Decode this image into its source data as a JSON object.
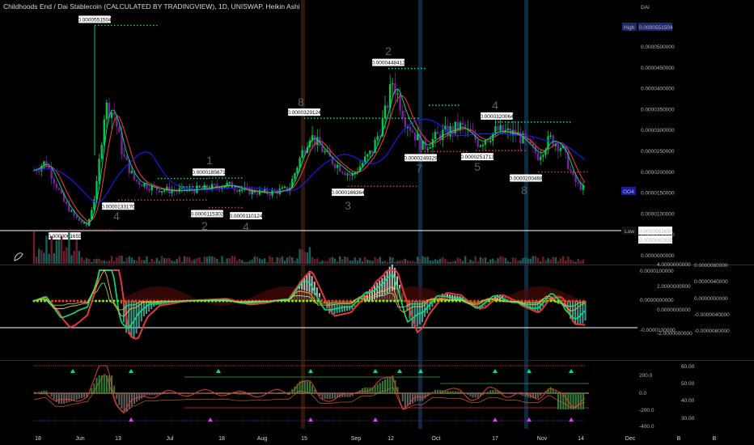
{
  "title": "Childhoods End / Dai Stablecoin (CALCULATED BY TRADINGVIEW), 1D, UNISWAP, Heikin Ashi",
  "currency": "DAI",
  "colors": {
    "background": "#000000",
    "up_candle": "#00c853",
    "down_candle": "#7b1fa2",
    "red_ma": "#e53935",
    "blue_ma": "#1a1aff",
    "green_ma": "#00e676",
    "level_green": "#00e676",
    "level_red": "#e53935"
  },
  "price_axis": {
    "ticks": [
      "0.0000500000",
      "0.0000450000",
      "0.0000400000",
      "0.0000350000",
      "0.0000300000",
      "0.0000250000",
      "0.0000200000",
      "0.0000150000",
      "0.0000100000",
      "0.0000050000",
      "0.0000000000"
    ],
    "high_label": "High",
    "high_value": "0.0000551504",
    "low_label": "Low",
    "low_value": "0.0000061655",
    "last_value": "0.0000061655",
    "current_tag": "OO4"
  },
  "x_axis": {
    "labels": [
      "18",
      "Jun",
      "13",
      "Jul",
      "18",
      "Aug",
      "15",
      "Sep",
      "12",
      "Oct",
      "17",
      "Nov",
      "14",
      "Dec",
      "B",
      "B"
    ]
  },
  "annotations": [
    {
      "text": "0.0000551504",
      "kind": "high"
    },
    {
      "text": "0.0000448412",
      "kind": "high"
    },
    {
      "text": "0.0000329124",
      "kind": "high"
    },
    {
      "text": "0.0000320064",
      "kind": "high"
    },
    {
      "text": "0.0000185671",
      "kind": "high"
    },
    {
      "text": "0.0000133170",
      "kind": "low"
    },
    {
      "text": "0.0000115302",
      "kind": "low"
    },
    {
      "text": "0.0000110124",
      "kind": "low"
    },
    {
      "text": "0.0000166364",
      "kind": "low"
    },
    {
      "text": "0.0000249329",
      "kind": "low"
    },
    {
      "text": "0.0000251713",
      "kind": "low"
    },
    {
      "text": "0.0000200468",
      "kind": "low"
    },
    {
      "text": "0.0000061655",
      "kind": "low"
    }
  ],
  "wave_numbers": [
    "4",
    "1",
    "2",
    "4",
    "8",
    "3",
    "2",
    "7",
    "5",
    "4",
    "8"
  ],
  "osc_axis": {
    "left_ticks": [
      "0.0000100000",
      "0.0000000000",
      "-0.0000100000"
    ],
    "mid_ticks": [
      "4.0000000000",
      "2.0000000000",
      "0.0000000000",
      "-2.0000000000"
    ],
    "right_ticks": [
      "0.0000080000",
      "0.0000040000",
      "0.0000000000",
      "-0.0000040000",
      "-0.0000080000"
    ]
  },
  "rsi_axis": {
    "left_ticks": [
      "200.0",
      "0.0",
      "-200.0",
      "-400.0"
    ],
    "right_ticks": [
      "60.00",
      "50.00",
      "40.00",
      "30.00"
    ]
  },
  "chart_data": {
    "type": "candlestick",
    "title": "Childhoods End / Dai Stablecoin (CALCULATED BY TRADINGVIEW), 1D, UNISWAP, Heikin Ashi",
    "ylim": [
      0,
      5.6e-05
    ],
    "y_unit": "DAI",
    "high": 5.51504e-05,
    "low": 6.1655e-06,
    "close_series": [
      {
        "date": "May 14",
        "value": 2.05e-05
      },
      {
        "date": "May 18",
        "value": 2.25e-05
      },
      {
        "date": "May 24",
        "value": 1.3e-05
      },
      {
        "date": "May 28",
        "value": 9e-06
      },
      {
        "date": "Jun 01",
        "value": 7e-06
      },
      {
        "date": "Jun 04",
        "value": 1.6e-05
      },
      {
        "date": "Jun 07",
        "value": 3.6e-05
      },
      {
        "date": "Jun 10",
        "value": 3.4e-05
      },
      {
        "date": "Jun 13",
        "value": 2.4e-05
      },
      {
        "date": "Jun 17",
        "value": 1.8e-05
      },
      {
        "date": "Jun 24",
        "value": 1.6e-05
      },
      {
        "date": "Jul 01",
        "value": 1.55e-05
      },
      {
        "date": "Jul 10",
        "value": 1.6e-05
      },
      {
        "date": "Jul 18",
        "value": 1.7e-05
      },
      {
        "date": "Jul 25",
        "value": 1.55e-05
      },
      {
        "date": "Aug 01",
        "value": 1.5e-05
      },
      {
        "date": "Aug 08",
        "value": 1.6e-05
      },
      {
        "date": "Aug 12",
        "value": 2.4e-05
      },
      {
        "date": "Aug 15",
        "value": 2.9e-05
      },
      {
        "date": "Aug 22",
        "value": 2.3e-05
      },
      {
        "date": "Aug 29",
        "value": 1.9e-05
      },
      {
        "date": "Sep 05",
        "value": 2.5e-05
      },
      {
        "date": "Sep 09",
        "value": 3.3e-05
      },
      {
        "date": "Sep 12",
        "value": 4.2e-05
      },
      {
        "date": "Sep 16",
        "value": 3.3e-05
      },
      {
        "date": "Sep 22",
        "value": 2.6e-05
      },
      {
        "date": "Sep 28",
        "value": 2.9e-05
      },
      {
        "date": "Oct 05",
        "value": 3.1e-05
      },
      {
        "date": "Oct 11",
        "value": 2.7e-05
      },
      {
        "date": "Oct 17",
        "value": 3e-05
      },
      {
        "date": "Oct 24",
        "value": 2.9e-05
      },
      {
        "date": "Oct 31",
        "value": 2.4e-05
      },
      {
        "date": "Nov 04",
        "value": 2.8e-05
      },
      {
        "date": "Nov 08",
        "value": 2.6e-05
      },
      {
        "date": "Nov 12",
        "value": 1.8e-05
      },
      {
        "date": "Nov 16",
        "value": 1.55e-05
      }
    ]
  }
}
